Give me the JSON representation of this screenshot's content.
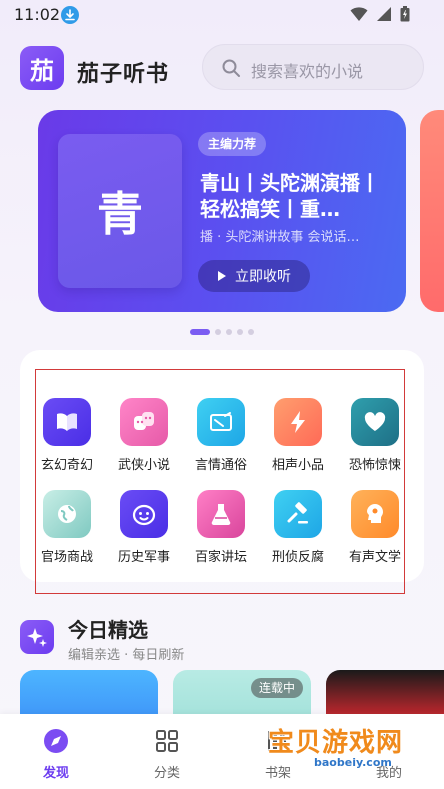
{
  "status": {
    "time": "11:02"
  },
  "header": {
    "logo_char": "茄",
    "app_name": "茄子听书",
    "search_placeholder": "搜索喜欢的小说"
  },
  "banner": {
    "badge": "主编力荐",
    "cover_char": "青",
    "title": "青山丨头陀渊演播丨轻松搞笑丨重…",
    "subtitle": "播 · 头陀渊讲故事  会说话…",
    "button_label": "立即收听",
    "dots_count": 5,
    "active_dot": 0
  },
  "categories": [
    {
      "label": "玄幻奇幻",
      "icon": "book-open-icon",
      "color": "#5b3df0"
    },
    {
      "label": "武侠小说",
      "icon": "masks-icon",
      "color": "#ef6fb8"
    },
    {
      "label": "言情通俗",
      "icon": "letter-icon",
      "color": "#27b6e6"
    },
    {
      "label": "相声小品",
      "icon": "lightning-icon",
      "color": "#ff7a5a"
    },
    {
      "label": "恐怖惊悚",
      "icon": "heart-icon",
      "color": "#2d8f9c"
    },
    {
      "label": "官场商战",
      "icon": "globe-icon",
      "color": "#8fd0c8"
    },
    {
      "label": "历史军事",
      "icon": "face-icon",
      "color": "#5b3df0"
    },
    {
      "label": "百家讲坛",
      "icon": "flask-icon",
      "color": "#e35ab0"
    },
    {
      "label": "刑侦反腐",
      "icon": "gavel-icon",
      "color": "#21b0ea"
    },
    {
      "label": "有声文学",
      "icon": "bulb-head-icon",
      "color": "#ff9a3a"
    }
  ],
  "today": {
    "title": "今日精选",
    "subtitle": "编辑亲选 · 每日刷新",
    "tag": "连载中"
  },
  "tabs": [
    {
      "label": "发现",
      "icon": "compass-icon",
      "active": true
    },
    {
      "label": "分类",
      "icon": "grid-icon",
      "active": false
    },
    {
      "label": "书架",
      "icon": "shelf-icon",
      "active": false
    },
    {
      "label": "我的",
      "icon": "user-icon",
      "active": false
    }
  ],
  "watermark": {
    "text": "宝贝游戏网",
    "url": "baobeiy.com"
  }
}
